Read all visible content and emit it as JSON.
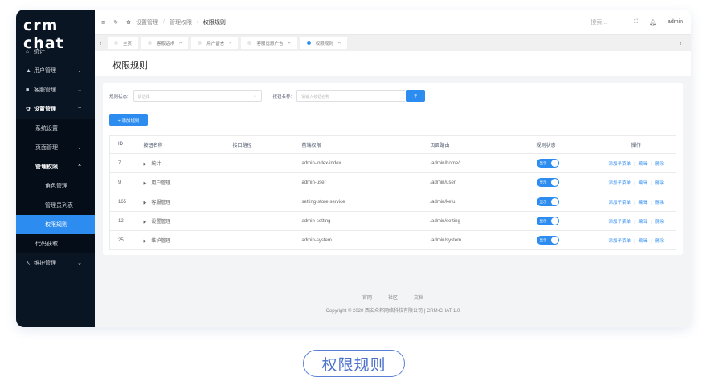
{
  "logo": "crm chat",
  "sidebar": {
    "items": [
      {
        "label": "统计",
        "icon": "home-icon"
      },
      {
        "label": "用户管理",
        "icon": "user-icon"
      },
      {
        "label": "客服管理",
        "icon": "chat-icon"
      },
      {
        "label": "设置管理",
        "icon": "gear-icon"
      },
      {
        "label": "系统设置"
      },
      {
        "label": "页面管理"
      },
      {
        "label": "管理权限"
      },
      {
        "label": "角色管理"
      },
      {
        "label": "管理员列表"
      },
      {
        "label": "权限规则"
      },
      {
        "label": "代码获取"
      },
      {
        "label": "维护管理",
        "icon": "wrench-icon"
      }
    ]
  },
  "header": {
    "breadcrumb": [
      "设置管理",
      "管理权限",
      "权限规则"
    ],
    "search": "搜索...",
    "user": "admin"
  },
  "tabs": [
    "主页",
    "客服话术",
    "用户留言",
    "客服优惠广告",
    "权限规则"
  ],
  "page_title": "权限规则",
  "filter": {
    "status_label": "规则状态:",
    "status_placeholder": "请选择",
    "name_label": "按钮名称:",
    "name_placeholder": "请输入按钮名称"
  },
  "add_button": "+ 添加规则",
  "table": {
    "headers": [
      "ID",
      "按钮名称",
      "接口路径",
      "前端权限",
      "页面路由",
      "规则状态",
      "操作"
    ],
    "rows": [
      {
        "id": "7",
        "name": "统计",
        "api": "",
        "front": "admin-index-index",
        "route": "/admin/home/",
        "status": "显示"
      },
      {
        "id": "9",
        "name": "用户管理",
        "api": "",
        "front": "admin-user",
        "route": "/admin/user",
        "status": "显示"
      },
      {
        "id": "165",
        "name": "客服管理",
        "api": "",
        "front": "setting-store-service",
        "route": "/admin/kefu",
        "status": "显示"
      },
      {
        "id": "12",
        "name": "设置管理",
        "api": "",
        "front": "admin-setting",
        "route": "/admin/setting",
        "status": "显示"
      },
      {
        "id": "25",
        "name": "维护管理",
        "api": "",
        "front": "admin-system",
        "route": "/admin/system",
        "status": "显示"
      }
    ],
    "actions": [
      "添加子菜单",
      "编辑",
      "删除"
    ]
  },
  "footer": {
    "links": [
      "官网",
      "社区",
      "文档"
    ],
    "copyright": "Copyright © 2020 西安众邦网络科技有限公司 | CRM-CHAT 1.0"
  },
  "caption": "权限规则",
  "colors": {
    "accent": "#2d8cf0",
    "sidebar": "#0a1524"
  }
}
